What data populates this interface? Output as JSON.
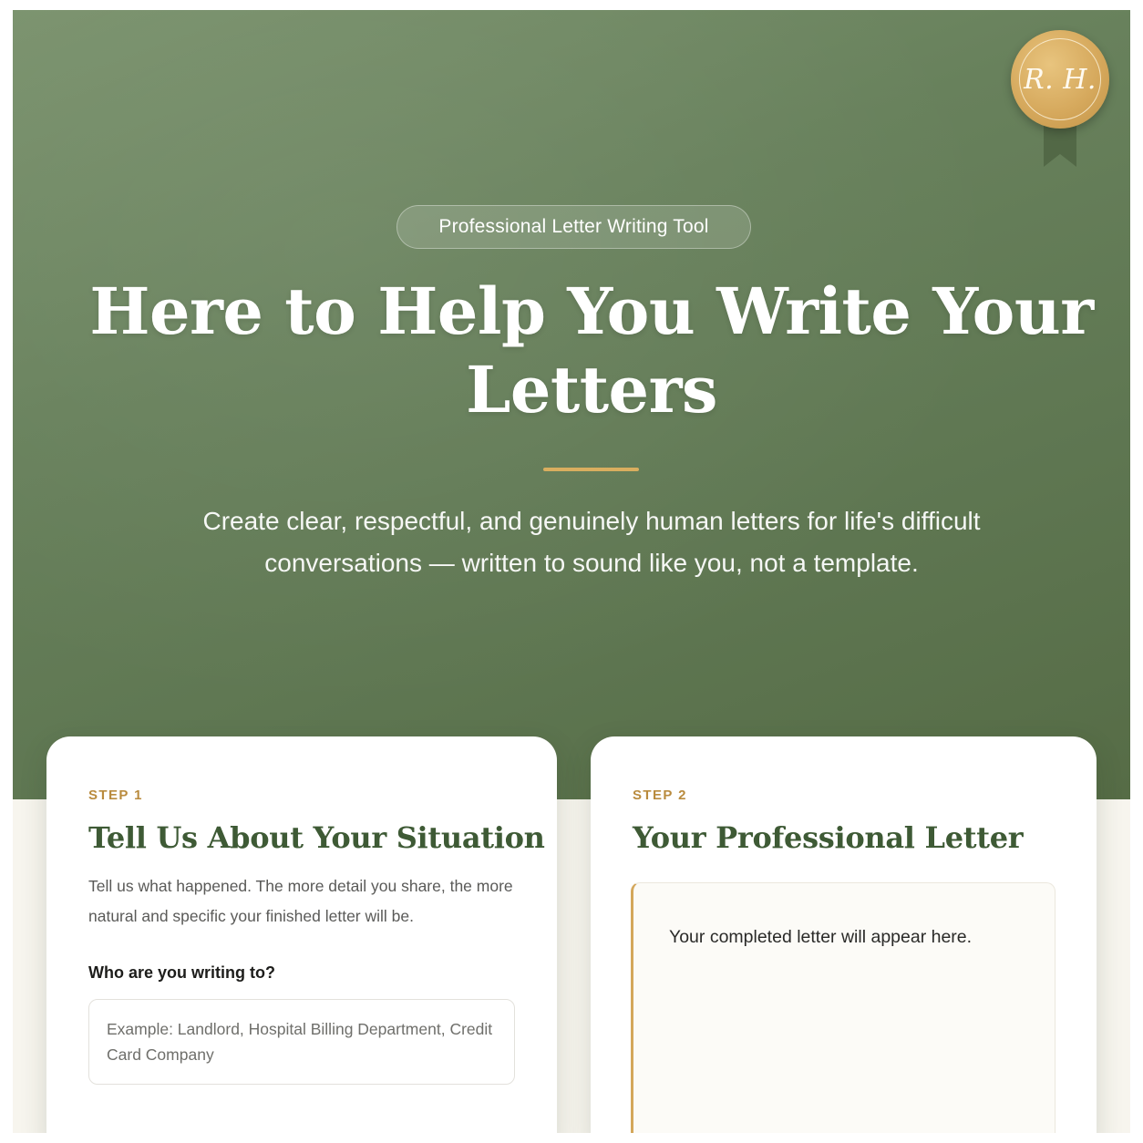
{
  "seal": {
    "initials": "R. H."
  },
  "hero": {
    "badge": "Professional Letter Writing Tool",
    "title": "Here to Help You Write Your Letters",
    "subtitle": "Create clear, respectful, and genuinely human letters for life's difficult conversations — written to sound like you, not a template."
  },
  "step1": {
    "label": "STEP 1",
    "title": "Tell Us About Your Situation",
    "description": "Tell us what happened. The more detail you share, the more natural and specific your finished letter will be.",
    "recipient_label": "Who are you writing to?",
    "recipient_placeholder": "Example: Landlord, Hospital Billing Department, Credit Card Company",
    "recipient_value": ""
  },
  "step2": {
    "label": "STEP 2",
    "title": "Your Professional Letter",
    "output_placeholder": "Your completed letter will appear here."
  },
  "colors": {
    "hero_green": "#668059",
    "gold_accent": "#d9ae5f",
    "title_green": "#3e5a35",
    "step_gold": "#b98b3e"
  }
}
